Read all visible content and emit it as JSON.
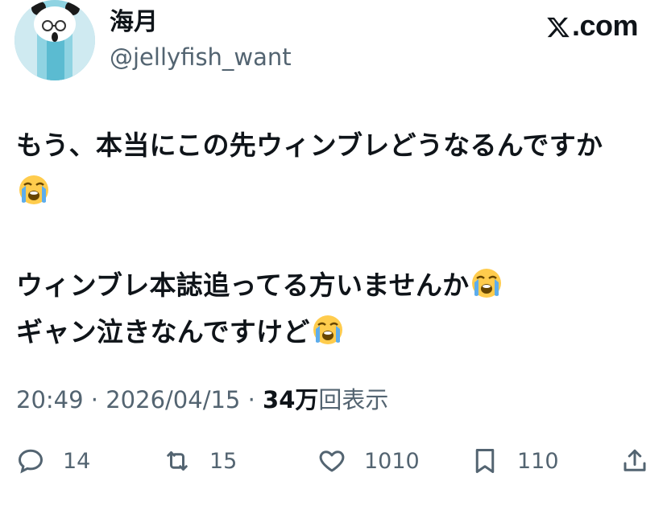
{
  "user": {
    "display_name": "海月",
    "handle": "@jellyfish_want"
  },
  "brand": {
    "label": ".com"
  },
  "tweet": {
    "lines": [
      "もう、本当にこの先ウィンブレどうなるんですか",
      "",
      "",
      "ウィンブレ本誌追ってる方いませんか",
      "ギャン泣きなんですけど"
    ],
    "emoji": "loudly-crying-face"
  },
  "meta": {
    "time": "20:49",
    "sep1": "·",
    "date": "2026/04/15",
    "sep2": "·",
    "views_count": "34万",
    "views_label": "回表示"
  },
  "actions": {
    "replies": "14",
    "reposts": "15",
    "likes": "1010",
    "bookmarks": "110"
  },
  "colors": {
    "text": "#0f1419",
    "muted": "#536471"
  }
}
